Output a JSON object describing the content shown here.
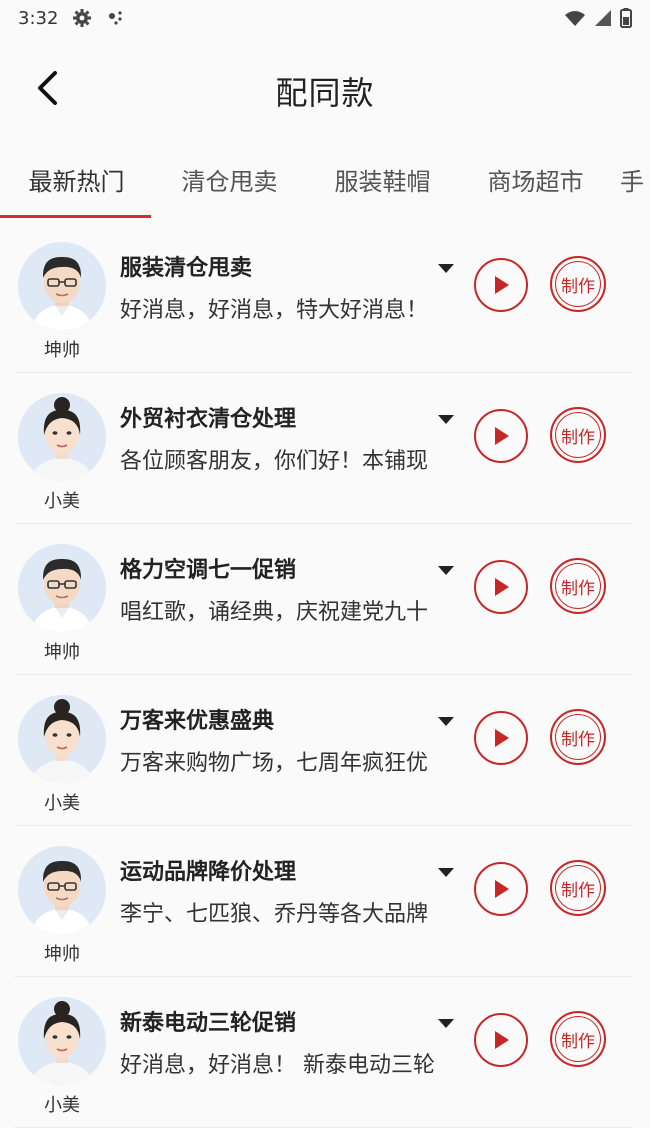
{
  "status_bar": {
    "time": "3:32",
    "icons": [
      "gear-icon",
      "signal-dots-icon",
      "wifi-icon",
      "cell-signal-icon",
      "battery-icon"
    ]
  },
  "header": {
    "title": "配同款",
    "back_icon": "chevron-left-icon"
  },
  "tabs": [
    {
      "label": "最新热门",
      "active": true
    },
    {
      "label": "清仓甩卖",
      "active": false
    },
    {
      "label": "服装鞋帽",
      "active": false
    },
    {
      "label": "商场超市",
      "active": false
    },
    {
      "label": "手",
      "active": false
    }
  ],
  "items": [
    {
      "title": "服装清仓甩卖",
      "text": "好消息，好消息，特大好消息！",
      "speaker": "坤帅",
      "avatar": "male",
      "make_label": "制作"
    },
    {
      "title": "外贸衬衣清仓处理",
      "text": "各位顾客朋友，你们好！本铺现",
      "speaker": "小美",
      "avatar": "female",
      "make_label": "制作"
    },
    {
      "title": "格力空调七一促销",
      "text": "唱红歌，诵经典，庆祝建党九十",
      "speaker": "坤帅",
      "avatar": "male",
      "make_label": "制作"
    },
    {
      "title": "万客来优惠盛典",
      "text": "万客来购物广场，七周年疯狂优",
      "speaker": "小美",
      "avatar": "female",
      "make_label": "制作"
    },
    {
      "title": "运动品牌降价处理",
      "text": "李宁、七匹狼、乔丹等各大品牌",
      "speaker": "坤帅",
      "avatar": "male",
      "make_label": "制作"
    },
    {
      "title": "新泰电动三轮促销",
      "text": "好消息，好消息！ 新泰电动三轮",
      "speaker": "小美",
      "avatar": "female",
      "make_label": "制作"
    }
  ],
  "colors": {
    "accent": "#c62828",
    "tab_indicator": "#d32f2f",
    "background": "#fafafa"
  }
}
